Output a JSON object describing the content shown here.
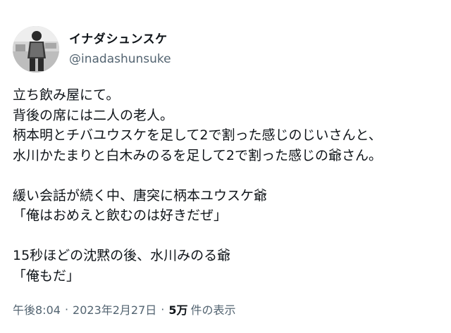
{
  "author": {
    "display_name": "イナダシュンスケ",
    "handle": "@inadashunsuke"
  },
  "tweet": {
    "lines": [
      "立ち飲み屋にて。",
      "背後の席には二人の老人。",
      "柄本明とチバユウスケを足して2で割った感じのじいさんと、",
      "水川かたまりと白木みのるを足して2で割った感じの爺さん。",
      "",
      "緩い会話が続く中、唐突に柄本ユウスケ爺",
      "「俺はおめえと飲むのは好きだぜ」",
      "",
      "15秒ほどの沈黙の後、水川みのる爺",
      "「俺もだ」"
    ]
  },
  "meta": {
    "time": "午後8:04",
    "separator": "·",
    "date": "2023年2月27日",
    "views_count": "5万",
    "views_label": "件の表示"
  },
  "colors": {
    "text": "#0f1419",
    "secondary": "#536471",
    "background": "#ffffff"
  }
}
